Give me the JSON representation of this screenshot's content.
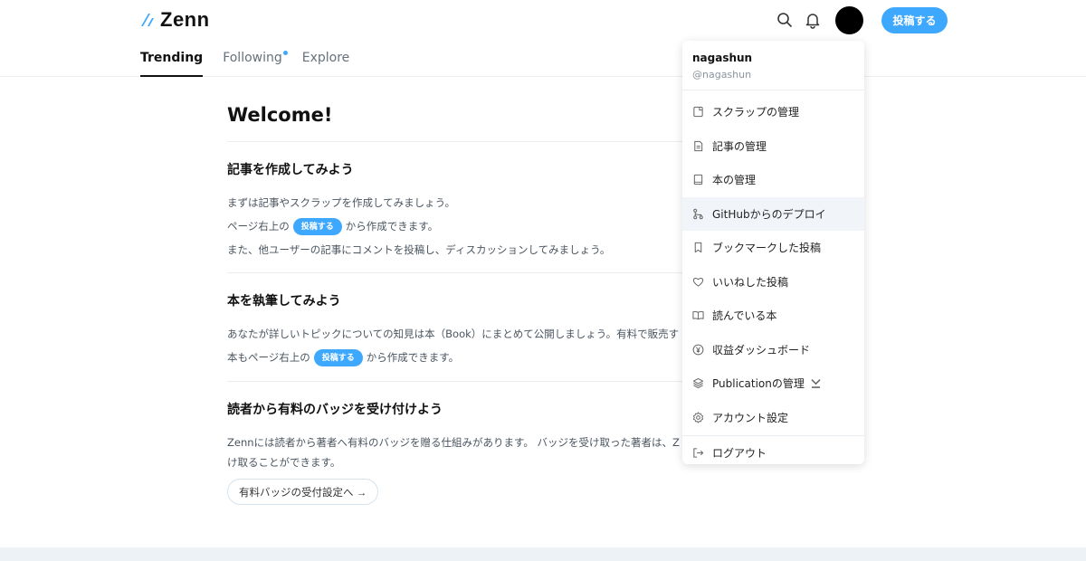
{
  "header": {
    "logo_text": "Zenn",
    "post_button": "投稿する",
    "tabs": [
      {
        "label": "Trending",
        "active": true
      },
      {
        "label": "Following",
        "has_dot": true
      },
      {
        "label": "Explore"
      }
    ]
  },
  "main": {
    "welcome": "Welcome!",
    "sections": [
      {
        "title": "記事を作成してみよう",
        "line1": "まずは記事やスクラップを作成してみましょう。",
        "line2_pre": "ページ右上の",
        "line2_badge": "投稿する",
        "line2_post": "から作成できます。",
        "line3": "また、他ユーザーの記事にコメントを投稿し、ディスカッションしてみましょう。"
      },
      {
        "title": "本を執筆してみよう",
        "line1": "あなたが詳しいトピックについての知見は本（Book）にまとめて公開しましょう。有料で販売す",
        "line2_pre": "本もページ右上の",
        "line2_badge": "投稿する",
        "line2_post": "から作成できます。"
      },
      {
        "title": "読者から有料のバッジを受け付けよう",
        "line1": "Zennには読者から著者へ有料のバッジを贈る仕組みがあります。 バッジを受け取った著者は、Z",
        "line2": "け取ることができます。",
        "button": "有料バッジの受付設定へ →"
      }
    ]
  },
  "menu": {
    "username": "nagashun",
    "handle": "@nagashun",
    "items": [
      {
        "label": "スクラップの管理",
        "icon": "scrap-icon"
      },
      {
        "label": "記事の管理",
        "icon": "document-icon"
      },
      {
        "label": "本の管理",
        "icon": "book-icon"
      },
      {
        "label": "GitHubからのデプロイ",
        "icon": "git-branch-icon",
        "hover": true
      },
      {
        "label": "ブックマークした投稿",
        "icon": "bookmark-icon"
      },
      {
        "label": "いいねした投稿",
        "icon": "heart-icon"
      },
      {
        "label": "読んでいる本",
        "icon": "open-book-icon"
      },
      {
        "label": "収益ダッシュボード",
        "icon": "yen-icon"
      },
      {
        "label": "Publicationの管理",
        "icon": "layers-icon"
      },
      {
        "label": "アカウント設定",
        "icon": "gear-icon"
      }
    ],
    "logout": "ログアウト"
  },
  "colors": {
    "accent": "#3ea8ff",
    "hover_bg": "#f1f5f9",
    "footer_band": "#edf2f7"
  }
}
